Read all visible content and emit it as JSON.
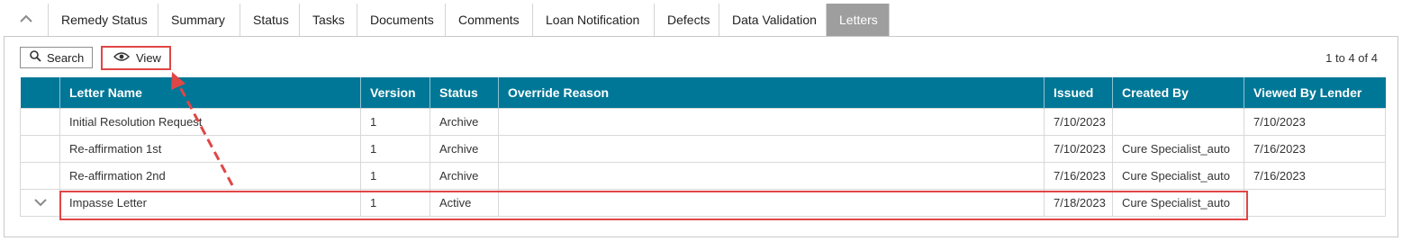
{
  "tabs": [
    {
      "label": "Remedy Status",
      "width": 122
    },
    {
      "label": "Summary",
      "width": 91
    },
    {
      "label": "Status",
      "width": 66
    },
    {
      "label": "Tasks",
      "width": 64
    },
    {
      "label": "Documents",
      "width": 98
    },
    {
      "label": "Comments",
      "width": 97
    },
    {
      "label": "Loan Notification",
      "width": 135
    },
    {
      "label": "Defects",
      "width": 72
    },
    {
      "label": "Data Validation",
      "width": 119
    },
    {
      "label": "Letters",
      "width": 70,
      "active": true
    }
  ],
  "toolbar": {
    "search_label": "Search",
    "view_label": "View"
  },
  "pager": {
    "text": "1 to 4 of 4"
  },
  "table": {
    "columns": [
      "",
      "Letter Name",
      "Version",
      "Status",
      "Override Reason",
      "Issued",
      "Created By",
      "Viewed By Lender"
    ],
    "rows": [
      {
        "letter_name": "Initial Resolution Request",
        "version": "1",
        "status": "Archive",
        "override_reason": "",
        "issued": "7/10/2023",
        "created_by": "",
        "viewed_by_lender": "7/10/2023",
        "expander": false
      },
      {
        "letter_name": "Re-affirmation 1st",
        "version": "1",
        "status": "Archive",
        "override_reason": "",
        "issued": "7/10/2023",
        "created_by": "Cure Specialist_auto",
        "viewed_by_lender": "7/16/2023",
        "expander": false
      },
      {
        "letter_name": "Re-affirmation 2nd",
        "version": "1",
        "status": "Archive",
        "override_reason": "",
        "issued": "7/16/2023",
        "created_by": "Cure Specialist_auto",
        "viewed_by_lender": "7/16/2023",
        "expander": false
      },
      {
        "letter_name": "Impasse Letter",
        "version": "1",
        "status": "Active",
        "override_reason": "",
        "issued": "7/18/2023",
        "created_by": "Cure Specialist_auto",
        "viewed_by_lender": "",
        "expander": true
      }
    ]
  },
  "colors": {
    "header_bg": "#007797",
    "active_tab_bg": "#9e9e9e",
    "annotation": "#e04646"
  }
}
